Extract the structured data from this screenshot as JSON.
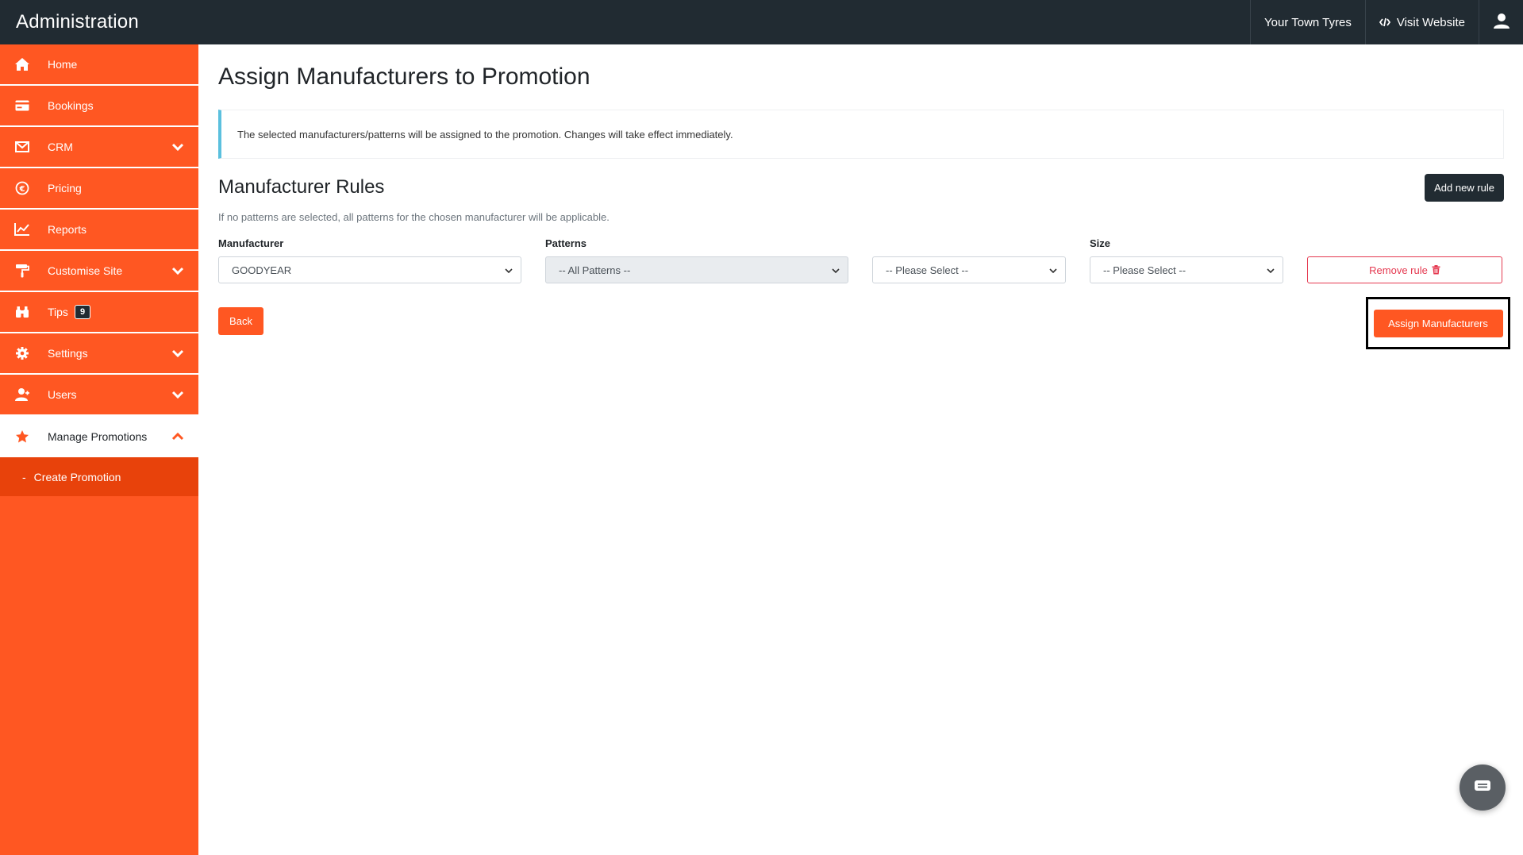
{
  "topbar": {
    "brand": "Administration",
    "store_name": "Your Town Tyres",
    "visit_website": "Visit Website"
  },
  "sidebar": {
    "items": [
      {
        "label": "Home",
        "icon": "home-icon"
      },
      {
        "label": "Bookings",
        "icon": "credit-card-icon"
      },
      {
        "label": "CRM",
        "icon": "envelope-icon"
      },
      {
        "label": "Pricing",
        "icon": "euro-icon"
      },
      {
        "label": "Reports",
        "icon": "chart-line-icon"
      },
      {
        "label": "Customise Site",
        "icon": "paint-roller-icon"
      },
      {
        "label": "Tips",
        "icon": "binoculars-icon",
        "badge": "9"
      },
      {
        "label": "Settings",
        "icon": "gear-icon"
      },
      {
        "label": "Users",
        "icon": "user-icon"
      },
      {
        "label": "Manage Promotions",
        "icon": "star-icon"
      }
    ],
    "sub_items": [
      {
        "label": "Create Promotion"
      }
    ]
  },
  "main": {
    "title": "Assign Manufacturers to Promotion",
    "alert": "The selected manufacturers/patterns will be assigned to the promotion. Changes will take effect immediately.",
    "section_title": "Manufacturer Rules",
    "add_rule": "Add new rule",
    "help_text": "If no patterns are selected, all patterns for the chosen manufacturer will be applicable.",
    "rule": {
      "manufacturer_label": "Manufacturer",
      "manufacturer_value": "GOODYEAR",
      "patterns_label": "Patterns",
      "patterns_value": "-- All Patterns --",
      "third_value": "-- Please Select --",
      "size_label": "Size",
      "size_value": "-- Please Select --",
      "remove": "Remove rule"
    },
    "back": "Back",
    "assign": "Assign Manufacturers"
  },
  "colors": {
    "accent": "#ff5722",
    "topbar": "#212b32",
    "info": "#5bc0de",
    "danger": "#e53950"
  }
}
